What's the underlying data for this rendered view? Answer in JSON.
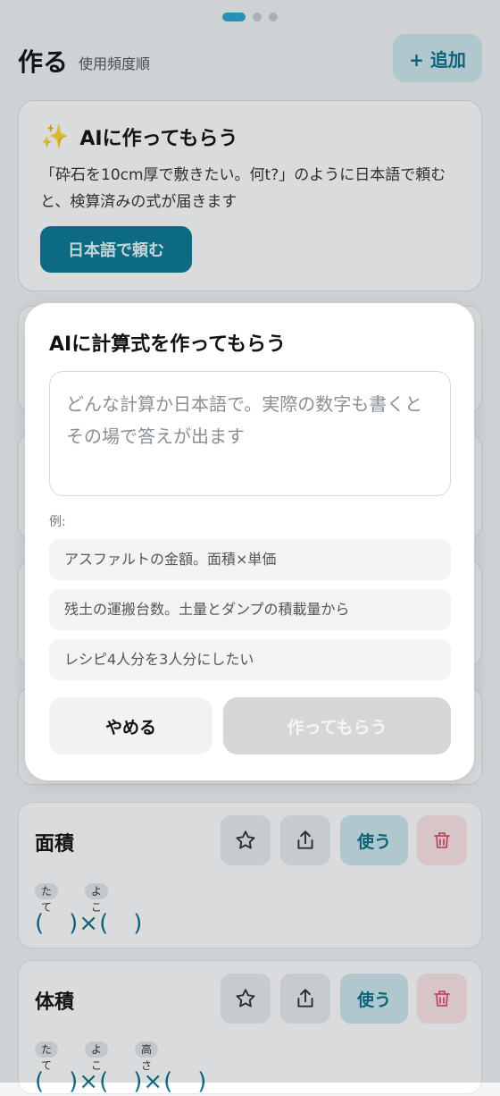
{
  "header": {
    "title": "作る",
    "sort_label": "使用頻度順",
    "add_label": "+ 追加"
  },
  "ai_card": {
    "sparkle_icon": "sparkles-icon",
    "title": "AIに作ってもらう",
    "description": "「砕石を10cm厚で敷きたい。何t?」のように日本語で頼むと、検算済みの式が届きます",
    "button_label": "日本語で頼む"
  },
  "formulas": [
    {
      "name": "面積",
      "use_label": "使う",
      "chips": [
        "たて",
        "よこ"
      ],
      "expression": "(　)×(　)"
    },
    {
      "name": "体積",
      "use_label": "使う",
      "chips": [
        "たて",
        "よこ",
        "高さ"
      ],
      "expression": "(　)×(　)×(　)"
    }
  ],
  "modal": {
    "title": "AIに計算式を作ってもらう",
    "placeholder": "どんな計算か日本語で。実際の数字も書くとその場で答えが出ます",
    "examples_label": "例:",
    "examples": [
      "アスファルトの金額。面積×単価",
      "残土の運搬台数。土量とダンプの積載量から",
      "レシピ4人分を3人分にしたい"
    ],
    "cancel_label": "やめる",
    "submit_label": "作ってもらう"
  },
  "colors": {
    "accent": "#0b7a96",
    "accent_light": "#cfe8ef",
    "danger": "#e0506a",
    "sparkle": "#f5c242"
  }
}
